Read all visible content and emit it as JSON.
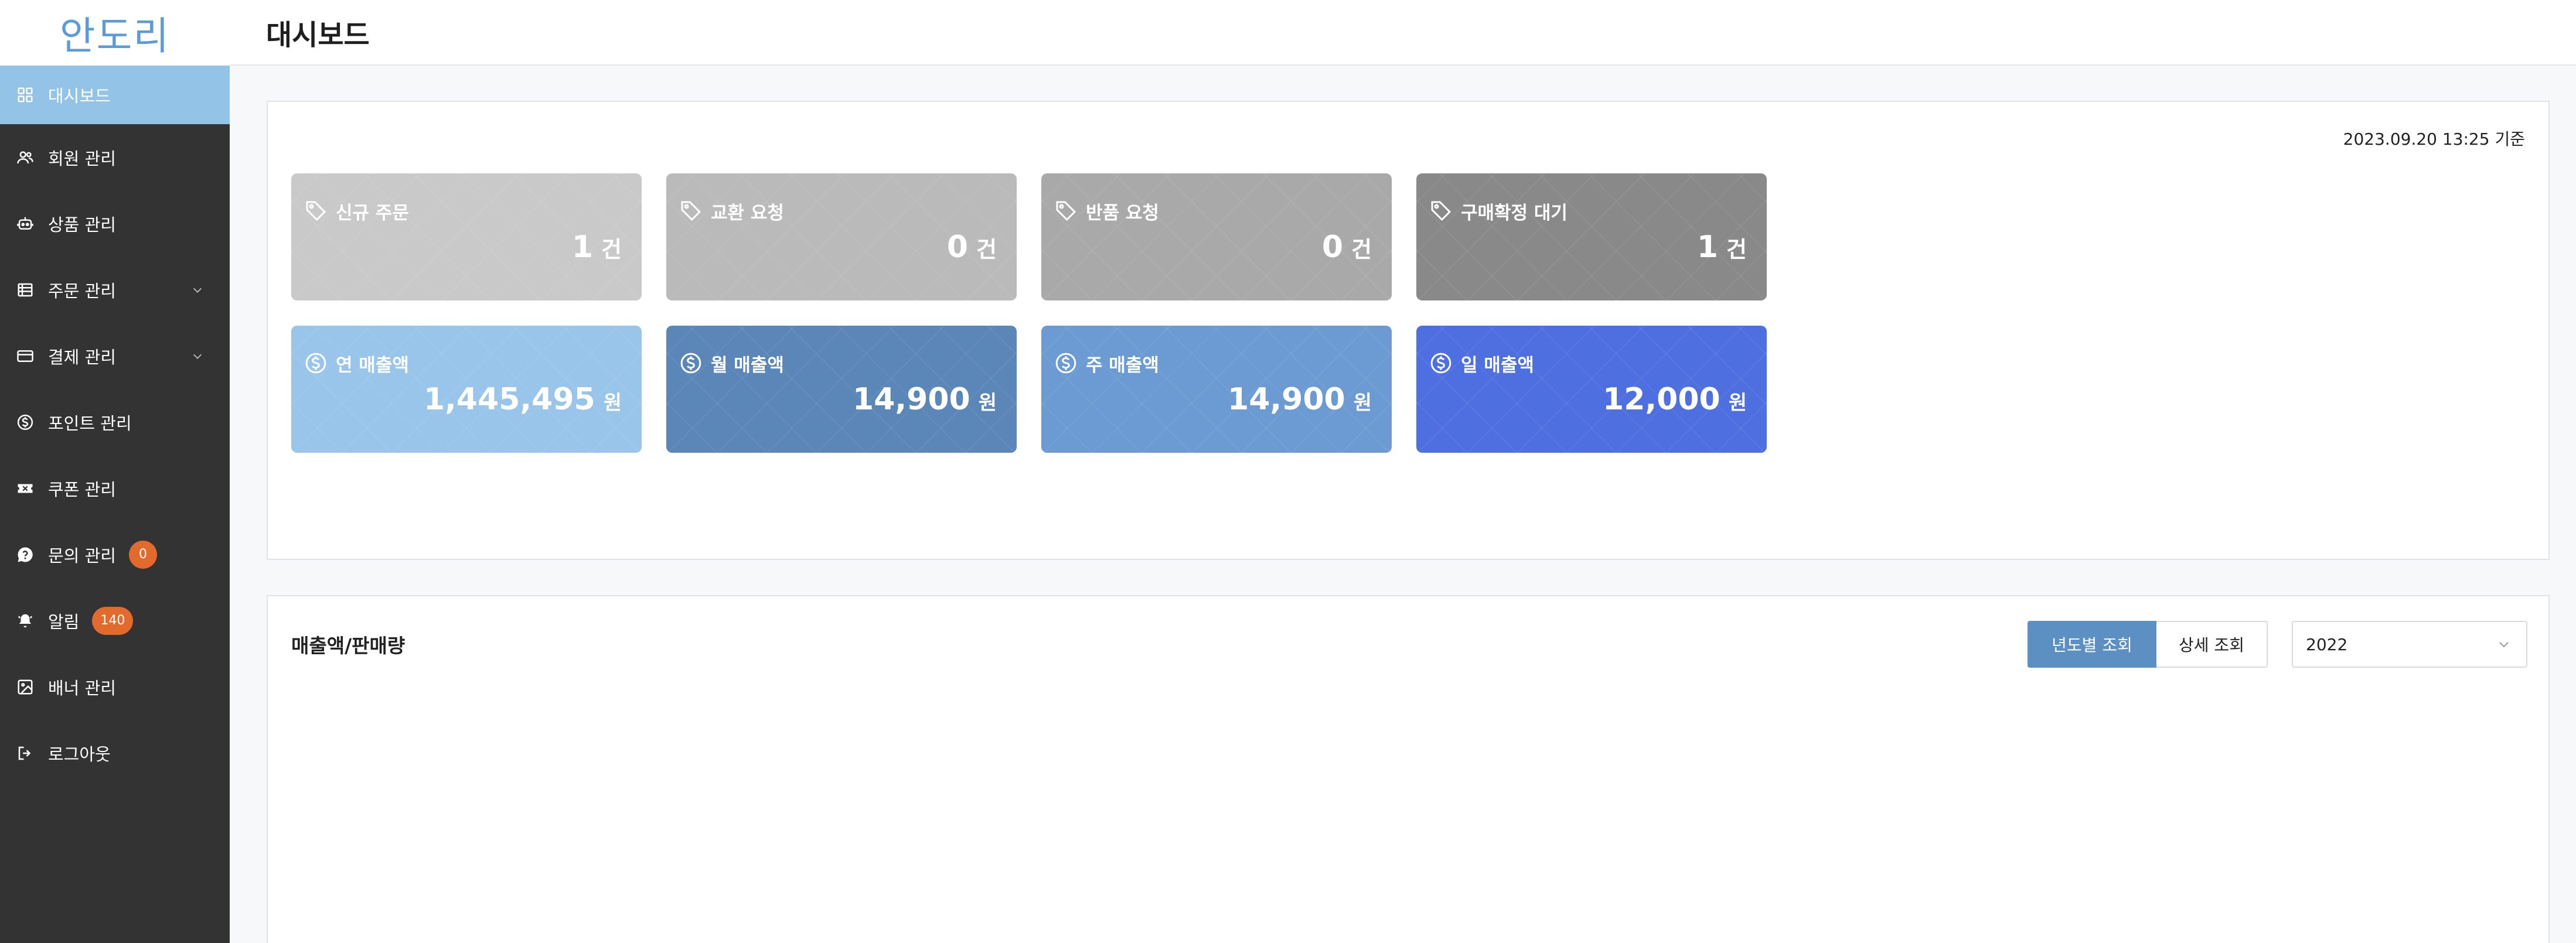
{
  "logo": {
    "text": "안도리"
  },
  "sidebar": {
    "items": [
      {
        "label": "대시보드",
        "icon": "dashboard-grid-icon",
        "active": true
      },
      {
        "label": "회원 관리",
        "icon": "users-icon"
      },
      {
        "label": "상품 관리",
        "icon": "robot-box-icon"
      },
      {
        "label": "주문 관리",
        "icon": "list-table-icon",
        "expandable": true
      },
      {
        "label": "결제 관리",
        "icon": "credit-card-icon",
        "expandable": true
      },
      {
        "label": "포인트 관리",
        "icon": "dollar-circle-icon"
      },
      {
        "label": "쿠폰 관리",
        "icon": "ticket-icon"
      },
      {
        "label": "문의 관리",
        "icon": "question-bubble-icon",
        "badge": "0"
      },
      {
        "label": "알림",
        "icon": "bell-icon",
        "badge": "140"
      },
      {
        "label": "배너 관리",
        "icon": "image-icon"
      },
      {
        "label": "로그아웃",
        "icon": "logout-icon"
      }
    ]
  },
  "header": {
    "title": "대시보드"
  },
  "summary": {
    "timestamp": "2023.09.20 13:25 기준",
    "order_cards": [
      {
        "label": "신규 주문",
        "value": "1",
        "unit": "건",
        "icon": "tag-icon",
        "color": "#c9c9c9"
      },
      {
        "label": "교환 요청",
        "value": "0",
        "unit": "건",
        "icon": "tag-icon",
        "color": "#bababa"
      },
      {
        "label": "반품 요청",
        "value": "0",
        "unit": "건",
        "icon": "tag-icon",
        "color": "#a9a9a9"
      },
      {
        "label": "구매확정 대기",
        "value": "1",
        "unit": "건",
        "icon": "tag-icon",
        "color": "#898989"
      }
    ],
    "sales_cards": [
      {
        "label": "연 매출액",
        "value": "1,445,495",
        "unit": "원",
        "icon": "dollar-circle-icon",
        "color": "#99c5ea"
      },
      {
        "label": "월 매출액",
        "value": "14,900",
        "unit": "원",
        "icon": "dollar-circle-icon",
        "color": "#5b86b8"
      },
      {
        "label": "주 매출액",
        "value": "14,900",
        "unit": "원",
        "icon": "dollar-circle-icon",
        "color": "#6b9bd2"
      },
      {
        "label": "일 매출액",
        "value": "12,000",
        "unit": "원",
        "icon": "dollar-circle-icon",
        "color": "#4e6fe0"
      }
    ]
  },
  "sales_chart": {
    "title": "매출액/판매량",
    "buttons": {
      "yearly": "년도별 조회",
      "detail": "상세 조회"
    },
    "year_select": {
      "value": "2022"
    }
  }
}
